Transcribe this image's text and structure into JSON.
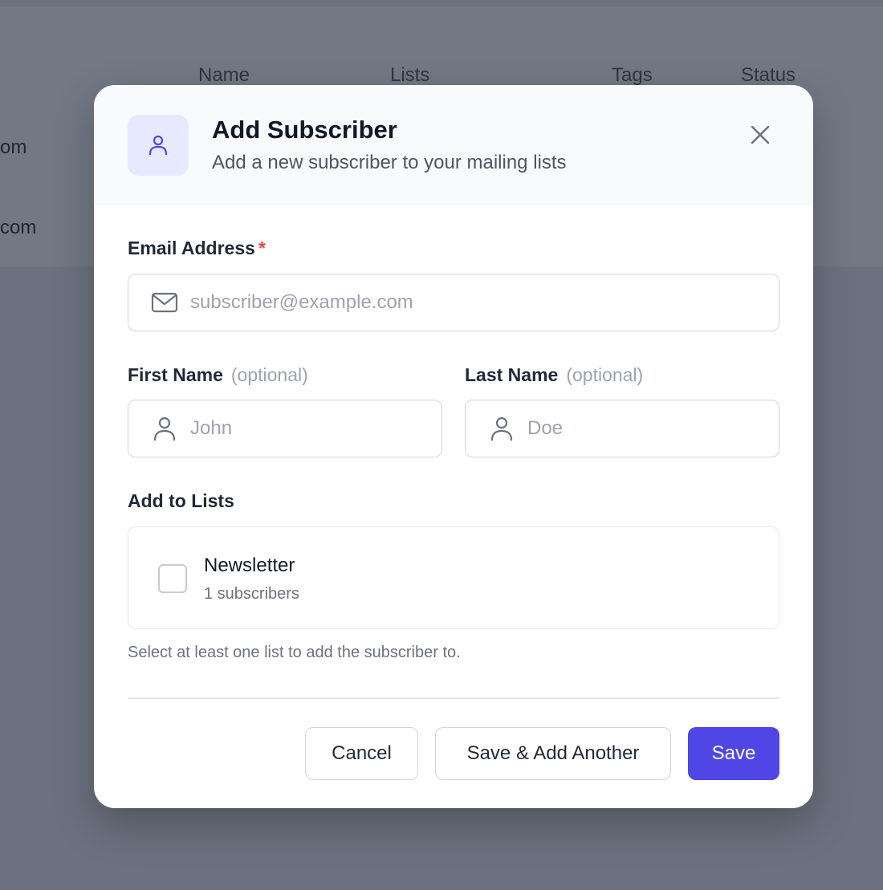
{
  "background": {
    "columns": [
      "Name",
      "Lists",
      "Tags",
      "Status"
    ],
    "row_fragments": [
      "om",
      "com"
    ]
  },
  "modal": {
    "icon": "user-icon",
    "title": "Add Subscriber",
    "subtitle": "Add a new subscriber to your mailing lists",
    "close_icon": "close-icon"
  },
  "form": {
    "email": {
      "label": "Email Address",
      "required_mark": "*",
      "placeholder": "subscriber@example.com",
      "icon": "mail-icon"
    },
    "first_name": {
      "label": "First Name",
      "optional": "(optional)",
      "placeholder": "John",
      "icon": "user-icon"
    },
    "last_name": {
      "label": "Last Name",
      "optional": "(optional)",
      "placeholder": "Doe",
      "icon": "user-icon"
    },
    "lists": {
      "label": "Add to Lists",
      "items": [
        {
          "name": "Newsletter",
          "count": "1 subscribers",
          "checked": false
        }
      ],
      "help": "Select at least one list to add the subscriber to."
    }
  },
  "actions": {
    "cancel": "Cancel",
    "save_add_another": "Save & Add Another",
    "save": "Save"
  },
  "colors": {
    "primary": "#4f46e5",
    "icon_bg": "#e7eafe",
    "required": "#ef4444",
    "overlay": "#6b717e"
  }
}
